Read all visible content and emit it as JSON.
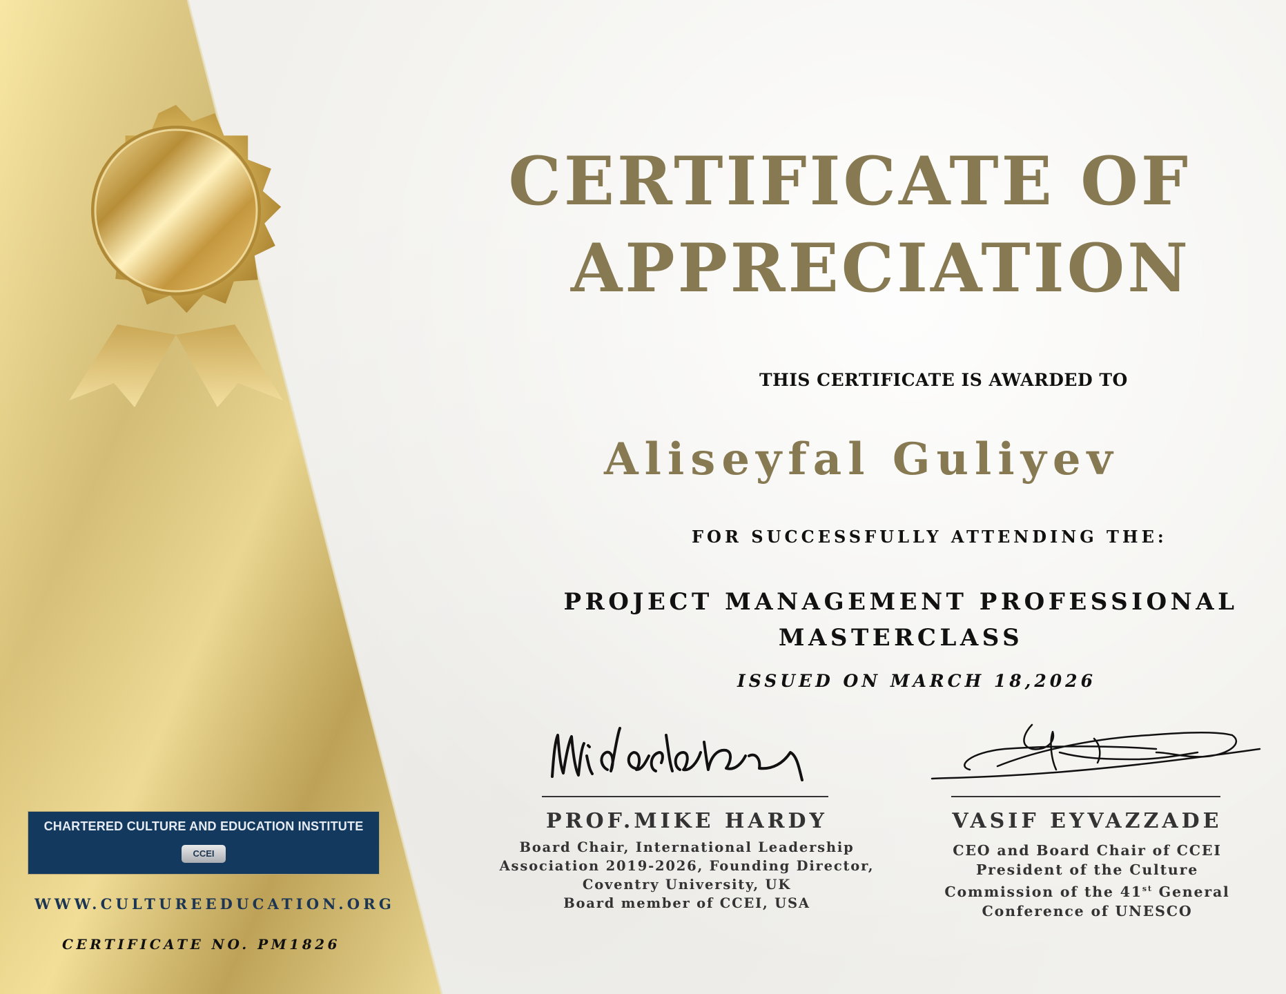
{
  "certificate": {
    "title_line1": "CERTIFICATE OF",
    "title_line2": "APPRECIATION",
    "awarded_to_label": "THIS CERTIFICATE IS AWARDED TO",
    "recipient_name": "Aliseyfal Guliyev",
    "for_label": "FOR SUCCESSFULLY ATTENDING THE:",
    "course_line1": "PROJECT MANAGEMENT PROFESSIONAL",
    "course_line2": "MASTERCLASS",
    "issued_on": "ISSUED ON MARCH 18,2026"
  },
  "signatories": [
    {
      "name": "PROF.MIKE HARDY",
      "description_lines": [
        "Board Chair, International Leadership",
        "Association 2019-2026, Founding Director,",
        "Coventry University, UK",
        "Board member of CCEI, USA"
      ]
    },
    {
      "name": "VASIF EYVAZZADE",
      "description_lines": [
        "CEO and Board Chair of CCEI",
        "President of the Culture"
      ],
      "desc_line3_before": "Commission of the 41",
      "desc_line3_sup": "st",
      "desc_line3_after": " General",
      "desc_line4": "Conference of UNESCO"
    }
  ],
  "institute": {
    "name": "CHARTERED CULTURE AND EDUCATION INSTITUTE",
    "badge": "CCEI",
    "website": "WWW.CULTUREEDUCATION.ORG",
    "certificate_number": "CERTIFICATE NO. PM1826"
  },
  "colors": {
    "title_gold": "#877a52",
    "gold_band_light": "#fbe9a6",
    "gold_band_dark": "#c9ad63",
    "institute_navy": "#133a5e"
  },
  "icons": [
    "gold-seal-icon",
    "ribbon-icon"
  ]
}
